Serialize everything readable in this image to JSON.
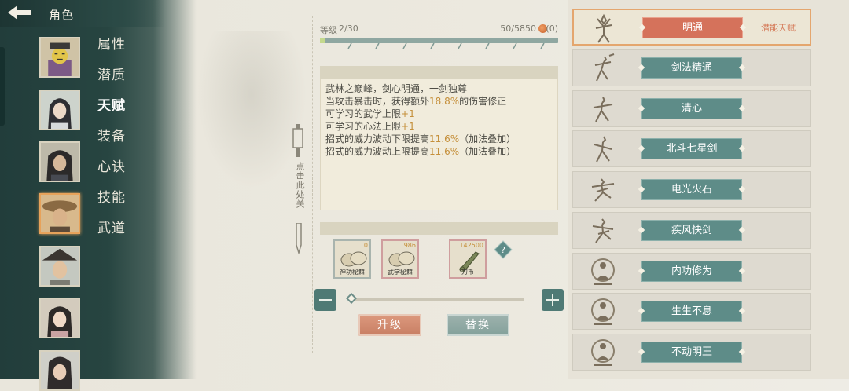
{
  "header": {
    "title": "角色"
  },
  "menu": [
    "属性",
    "潜质",
    "天赋",
    "装备",
    "心诀",
    "技能",
    "武道"
  ],
  "menu_active_index": 2,
  "characters": [
    {
      "name": "avatar-1"
    },
    {
      "name": "avatar-2"
    },
    {
      "name": "avatar-3"
    },
    {
      "name": "avatar-4"
    },
    {
      "name": "avatar-5"
    },
    {
      "name": "avatar-6"
    },
    {
      "name": "avatar-7"
    }
  ],
  "level": {
    "label": "等级",
    "value": "2/30",
    "exp": "50/5850",
    "coin": "0",
    "progress": 0.0085
  },
  "description": {
    "lines": [
      {
        "pre": "武林之巅峰，剑心明通，一剑独尊",
        "hl": "",
        "post": ""
      },
      {
        "pre": "当攻击暴击时，获得额外",
        "hl": "18.8%",
        "post": "的伤害修正"
      },
      {
        "pre": "可学习的武学上限",
        "hl": "+1",
        "post": ""
      },
      {
        "pre": "可学习的心法上限",
        "hl": "+1",
        "post": ""
      },
      {
        "pre": "招式的威力波动下限提高",
        "hl": "11.6%",
        "post": "（加法叠加）"
      },
      {
        "pre": "招式的威力波动上限提高",
        "hl": "11.6%",
        "post": "（加法叠加）"
      }
    ]
  },
  "hint": {
    "text": "点击此处关"
  },
  "items": [
    {
      "count": "0",
      "name": "神功秘籍"
    },
    {
      "count": "986",
      "name": "武学秘籍"
    },
    {
      "count": "142500",
      "name": "刀币"
    }
  ],
  "help_label": "?",
  "slider_value": 0,
  "buttons": {
    "upgrade": "升级",
    "replace": "替换"
  },
  "skills": [
    {
      "name": "明通",
      "tag": "潜能天赋",
      "selected": true
    },
    {
      "name": "剑法精通",
      "tag": "",
      "selected": false
    },
    {
      "name": "清心",
      "tag": "",
      "selected": false
    },
    {
      "name": "北斗七星剑",
      "tag": "",
      "selected": false
    },
    {
      "name": "电光火石",
      "tag": "",
      "selected": false
    },
    {
      "name": "疾风快剑",
      "tag": "",
      "selected": false
    },
    {
      "name": "内功修为",
      "tag": "",
      "selected": false
    },
    {
      "name": "生生不息",
      "tag": "",
      "selected": false
    },
    {
      "name": "不动明王",
      "tag": "",
      "selected": false
    }
  ],
  "colors": {
    "accent_selected": "#d5725b",
    "skill_button": "#5e8c88",
    "highlight_text": "#c58f3a",
    "sidebar": "#223d3b"
  }
}
